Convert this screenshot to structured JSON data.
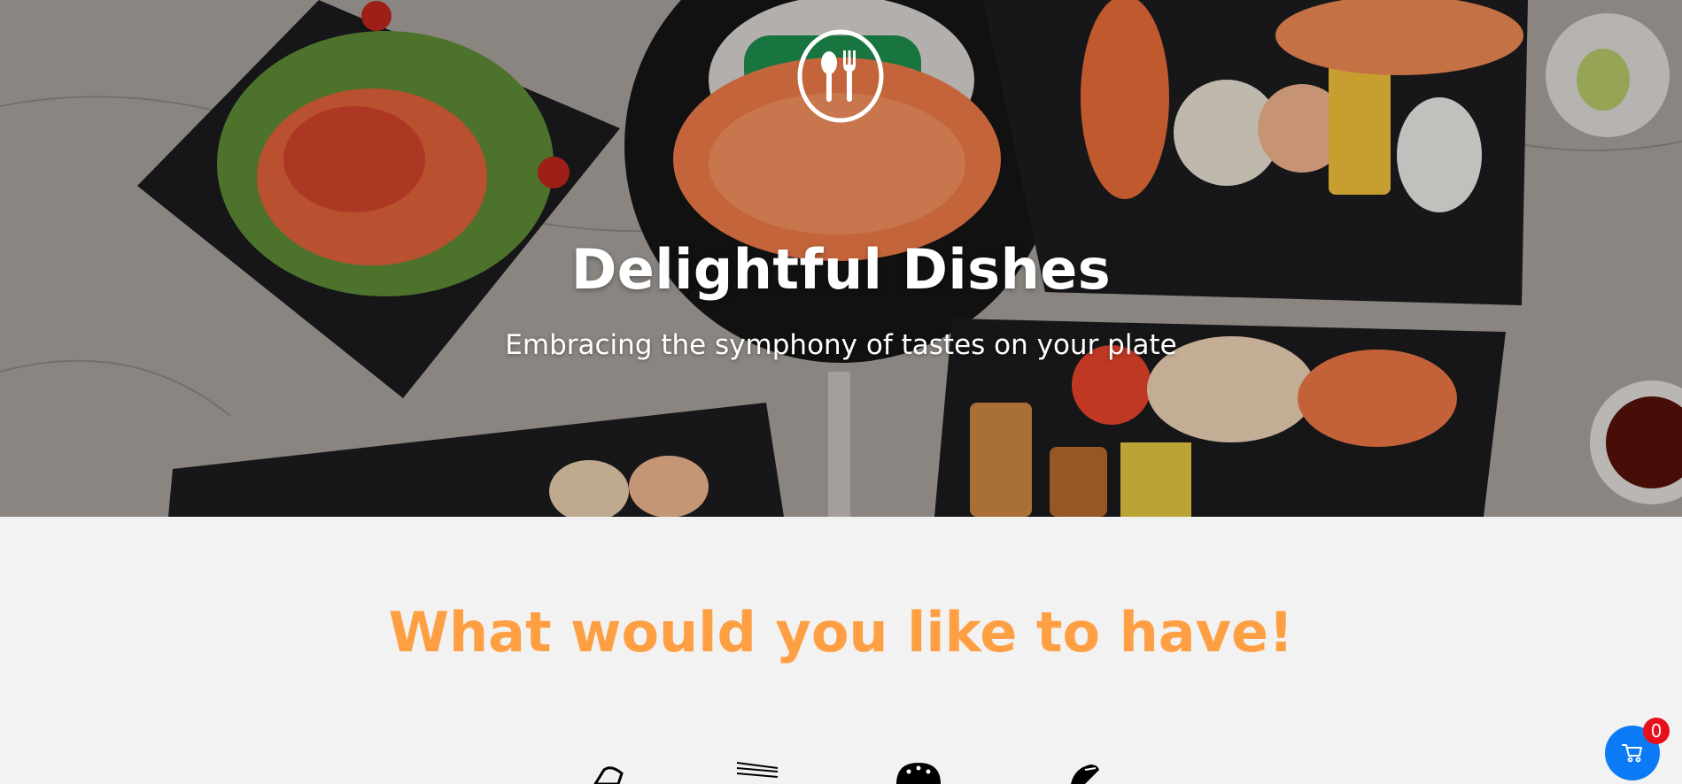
{
  "hero": {
    "title": "Delightful Dishes",
    "subtitle": "Embracing the symphony of tastes on your plate",
    "logo_icon": "spoon-fork-icon",
    "background": "sushi platter photo"
  },
  "menu": {
    "heading": "What would you like to have!",
    "categories": [
      {
        "icon": "nigiri-icon"
      },
      {
        "icon": "chopsticks-icon"
      },
      {
        "icon": "bowl-icon"
      },
      {
        "icon": "sushi-roll-icon"
      }
    ]
  },
  "cart": {
    "icon": "cart-icon",
    "count": "0"
  },
  "colors": {
    "accent": "#ff9f43",
    "cart_button": "#0b7bf5",
    "badge": "#e8101c",
    "page_bg": "#f2f2f2"
  }
}
